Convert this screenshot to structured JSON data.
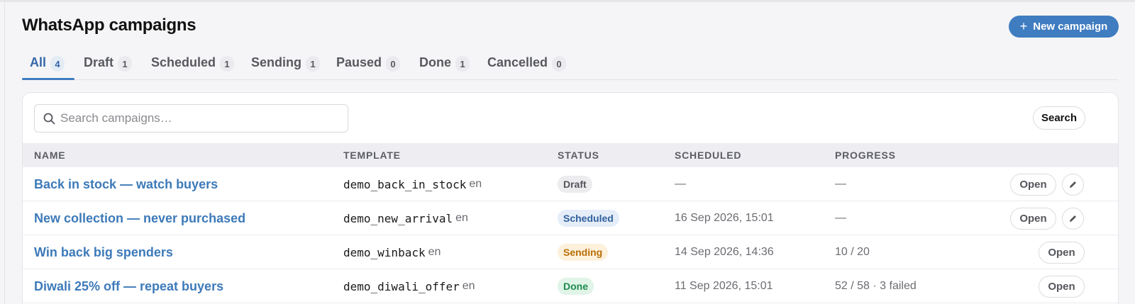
{
  "page": {
    "title": "WhatsApp campaigns",
    "new_button_label": "New campaign",
    "new_button_icon": "plus-icon",
    "accent_color": "#3f7cc0"
  },
  "tabs": [
    {
      "label": "All",
      "count": "4",
      "active": true
    },
    {
      "label": "Draft",
      "count": "1"
    },
    {
      "label": "Scheduled",
      "count": "1"
    },
    {
      "label": "Sending",
      "count": "1"
    },
    {
      "label": "Paused",
      "count": "0"
    },
    {
      "label": "Done",
      "count": "1"
    },
    {
      "label": "Cancelled",
      "count": "0"
    }
  ],
  "search": {
    "placeholder": "Search campaigns…",
    "value": "",
    "button_label": "Search",
    "icon": "search-icon"
  },
  "table": {
    "columns": [
      "NAME",
      "TEMPLATE",
      "STATUS",
      "SCHEDULED",
      "PROGRESS"
    ],
    "rows": [
      {
        "name": "Back in stock — watch buyers",
        "template": "demo_back_in_stock",
        "lang": "en",
        "status": "Draft",
        "scheduled": "—",
        "progress": "—",
        "open_label": "Open",
        "editable": true
      },
      {
        "name": "New collection — never purchased",
        "template": "demo_new_arrival",
        "lang": "en",
        "status": "Scheduled",
        "scheduled": "16 Sep 2026, 15:01",
        "progress": "—",
        "open_label": "Open",
        "editable": true
      },
      {
        "name": "Win back big spenders",
        "template": "demo_winback",
        "lang": "en",
        "status": "Sending",
        "scheduled": "14 Sep 2026, 14:36",
        "progress": "10 / 20",
        "open_label": "Open",
        "editable": false
      },
      {
        "name": "Diwali 25% off — repeat buyers",
        "template": "demo_diwali_offer",
        "lang": "en",
        "status": "Done",
        "scheduled": "11 Sep 2026, 15:01",
        "progress": "52 / 58 · 3 failed",
        "open_label": "Open",
        "editable": false
      }
    ]
  },
  "status_colors": {
    "Draft": {
      "bg": "#ececef",
      "fg": "#55565c"
    },
    "Scheduled": {
      "bg": "#e4edf8",
      "fg": "#2f5f9e"
    },
    "Sending": {
      "bg": "#fdf1dc",
      "fg": "#b86e07"
    },
    "Done": {
      "bg": "#e0f4e8",
      "fg": "#1f8a4c"
    }
  }
}
